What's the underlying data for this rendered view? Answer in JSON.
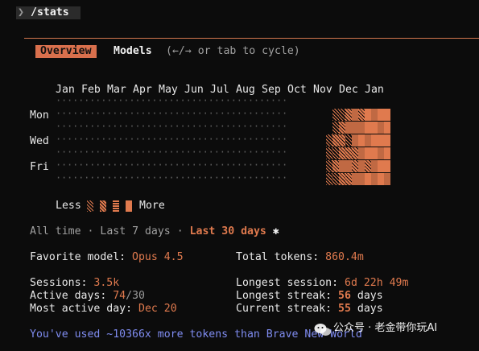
{
  "prompt": {
    "arrow": "❯",
    "command": "/stats"
  },
  "tabs": {
    "overview": "Overview",
    "models": "Models",
    "hint": "(←/→ or tab to cycle)"
  },
  "heatmap": {
    "months": [
      "Jan",
      "Feb",
      "Mar",
      "Apr",
      "May",
      "Jun",
      "Jul",
      "Aug",
      "Sep",
      "Oct",
      "Nov",
      "Dec",
      "Jan"
    ],
    "days": {
      "mon": "Mon",
      "wed": "Wed",
      "fri": "Fri"
    },
    "legend": {
      "less": "Less",
      "more": "More"
    },
    "color_high": "#e07a4e",
    "color_empty": "#5d5d5d",
    "activity_weeks": [
      [
        0,
        0,
        0,
        1,
        1,
        1,
        1
      ],
      [
        0,
        1,
        1,
        2,
        1,
        2,
        1
      ],
      [
        0,
        1,
        2,
        2,
        2,
        3,
        2
      ],
      [
        0,
        2,
        3,
        1,
        2,
        3,
        2
      ],
      [
        0,
        3,
        3,
        3,
        2,
        2,
        3
      ],
      [
        0,
        2,
        3,
        4,
        3,
        3,
        3
      ],
      [
        0,
        4,
        4,
        3,
        4,
        2,
        4
      ],
      [
        0,
        3,
        4,
        4,
        4,
        3,
        3
      ],
      [
        0,
        4,
        3,
        4,
        3,
        4,
        4
      ],
      [
        0,
        4,
        4,
        4,
        4,
        4,
        3
      ]
    ]
  },
  "ranges": {
    "all": "All time",
    "week": "Last 7 days",
    "month": "Last 30 days",
    "sep": "·",
    "star": "✱"
  },
  "stats": {
    "favorite_model_label": "Favorite model:",
    "favorite_model": "Opus 4.5",
    "total_tokens_label": "Total tokens:",
    "total_tokens": "860.4m",
    "sessions_label": "Sessions:",
    "sessions": "3.5k",
    "longest_session_label": "Longest session:",
    "longest_session": "6d 22h 49m",
    "active_days_label": "Active days:",
    "active_days": "74",
    "active_days_total": "/30",
    "longest_streak_label": "Longest streak:",
    "longest_streak": "56",
    "longest_streak_unit": "days",
    "most_active_day_label": "Most active day:",
    "most_active_day": "Dec 20",
    "current_streak_label": "Current streak:",
    "current_streak": "55",
    "current_streak_unit": "days"
  },
  "footer": "You've used ~10366x more tokens than Brave New World",
  "watermark": "公众号 · 老金带你玩AI"
}
